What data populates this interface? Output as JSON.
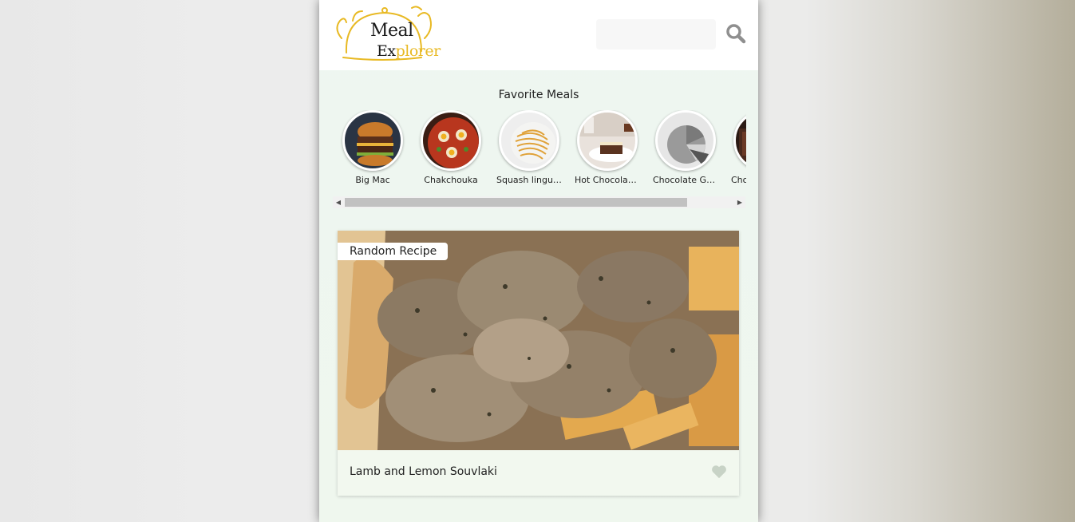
{
  "header": {
    "logo_line1": "Meal",
    "logo_line2_a": "Ex",
    "logo_line2_b": "plorer",
    "search_placeholder": "",
    "search_value": ""
  },
  "favorites": {
    "title": "Favorite Meals",
    "items": [
      {
        "name": "Big Mac"
      },
      {
        "name": "Chakchouka"
      },
      {
        "name": "Squash linguine"
      },
      {
        "name": "Hot Chocolate Fudge"
      },
      {
        "name": "Chocolate Gateau"
      },
      {
        "name": "Chocolate Souffle"
      }
    ]
  },
  "random": {
    "tag": "Random Recipe",
    "title": "Lamb and Lemon Souvlaki"
  },
  "colors": {
    "accent": "#e8b923",
    "heart": "#c8d3c6",
    "search_icon": "#8f8f8f"
  }
}
